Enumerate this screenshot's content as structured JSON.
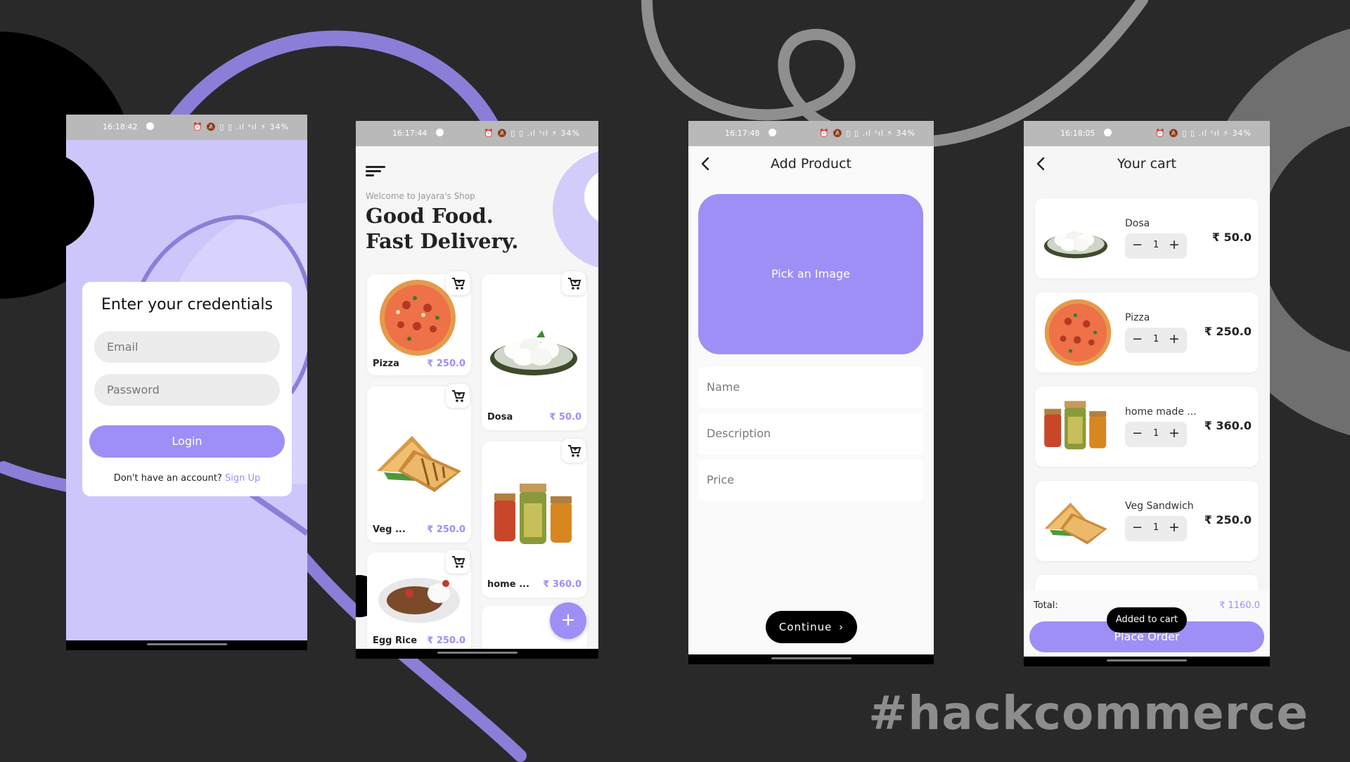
{
  "background": {
    "color": "#292929",
    "accent": "#8b7ed8",
    "hashtag": "#hackcommerce"
  },
  "colors": {
    "primary": "#9d8ff5",
    "login_bg": "#cdc6fb",
    "status_bar": "#b9b9b9"
  },
  "login": {
    "status_time": "16:18:42",
    "status_icons": "⏰ 🔕 ▯ ▯ .ıl ˢıl ⚡ 34%",
    "title": "Enter your credentials",
    "email_placeholder": "Email",
    "password_placeholder": "Password",
    "login_label": "Login",
    "signup_prompt": "Don't have an account?",
    "signup_link": "Sign Up"
  },
  "shop": {
    "status_time": "16:17:44",
    "status_icons": "⏰ 🔕 ▯ ▯ .ıl ˢıl ⚡ 34%",
    "welcome": "Welcome to Jayara's Shop",
    "headline_1": "Good Food.",
    "headline_2": "Fast Delivery.",
    "products": [
      {
        "name": "Pizza",
        "price": "₹ 250.0",
        "image": "pizza"
      },
      {
        "name": "Dosa",
        "price": "₹ 50.0",
        "image": "dosa"
      },
      {
        "name": "Veg ...",
        "price": "₹ 250.0",
        "image": "sandwich"
      },
      {
        "name": "home ...",
        "price": "₹ 360.0",
        "image": "pickle-jars"
      },
      {
        "name": "Egg Rice",
        "price": "₹ 250.0",
        "image": "egg-rice"
      }
    ],
    "fab_label": "+"
  },
  "add_product": {
    "status_time": "16:17:48",
    "status_icons": "⏰ 🔕 ▯ ▯ .ıl ˢıl ⚡ 34%",
    "title": "Add Product",
    "pick_image_label": "Pick an Image",
    "name_placeholder": "Name",
    "description_placeholder": "Description",
    "price_placeholder": "Price",
    "continue_label": "Continue"
  },
  "cart": {
    "status_time": "16:18:05",
    "status_icons": "⏰ 🔕 ▯ ▯ .ıl ˢıl ⚡ 34%",
    "title": "Your cart",
    "items": [
      {
        "name": "Dosa",
        "qty": "1",
        "price": "₹ 50.0",
        "image": "dosa"
      },
      {
        "name": "Pizza",
        "qty": "1",
        "price": "₹ 250.0",
        "image": "pizza"
      },
      {
        "name": "home made ...",
        "qty": "1",
        "price": "₹ 360.0",
        "image": "pickle-jars"
      },
      {
        "name": "Veg Sandwich",
        "qty": "1",
        "price": "₹ 250.0",
        "image": "sandwich"
      }
    ],
    "total_label": "Total:",
    "total_value": "₹ 1160.0",
    "toast": "Added to cart",
    "place_order_label": "Place Order"
  }
}
